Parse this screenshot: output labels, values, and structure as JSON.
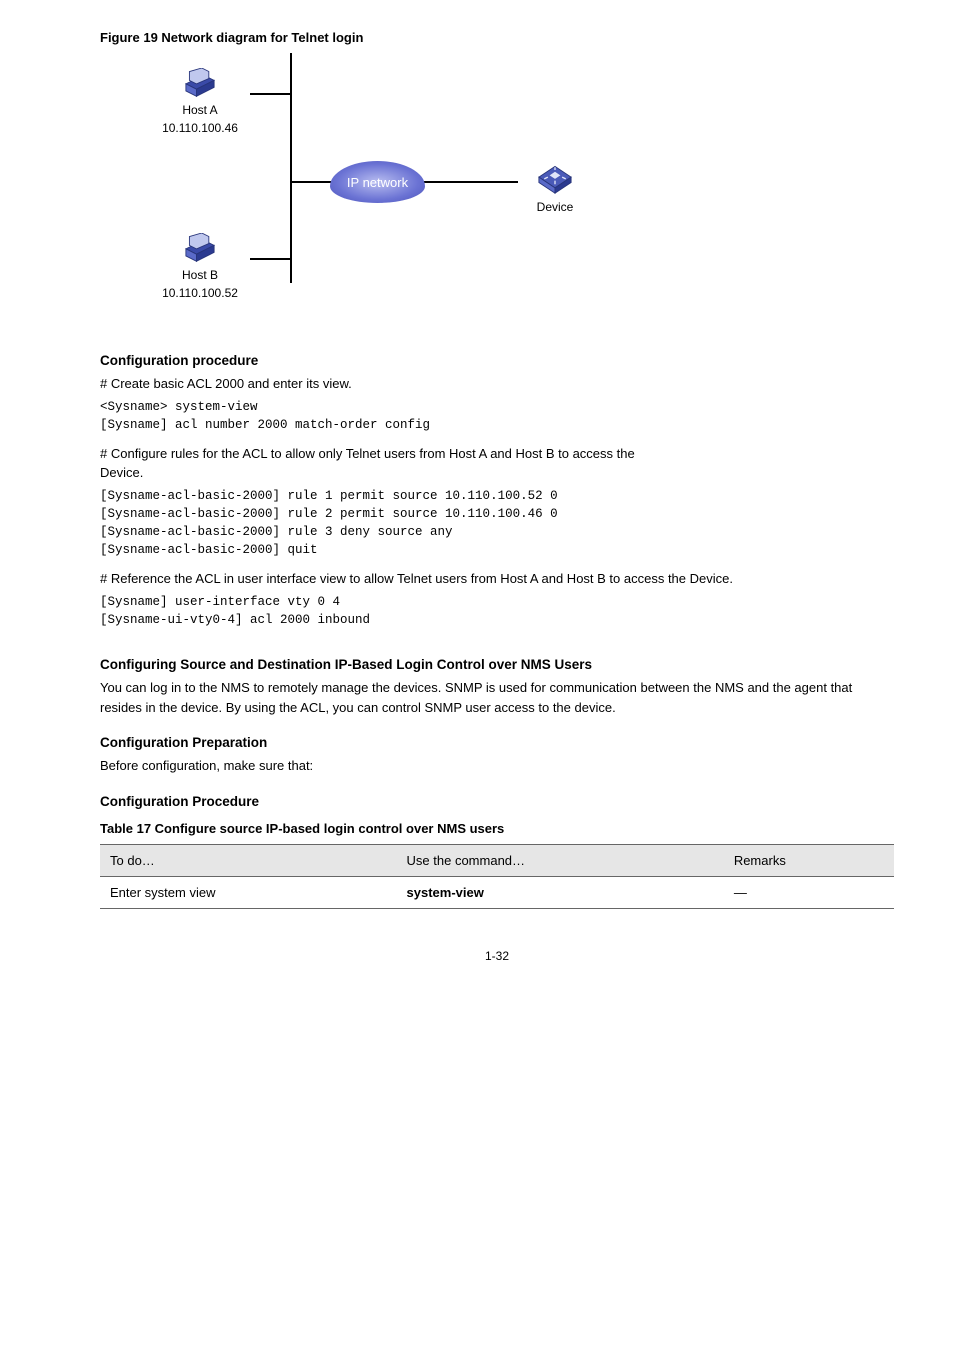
{
  "figure": {
    "caption": "Figure 19 Network diagram for Telnet login",
    "host_a": "Host A",
    "host_a_ip": "10.110.100.46",
    "host_b": "Host B",
    "host_b_ip": "10.110.100.52",
    "cloud": "IP network",
    "device": "Device"
  },
  "sec1": "Configuration procedure",
  "intro": "# Create basic ACL 2000 and enter its view.",
  "cmd1": "<Sysname> system-view",
  "cmd2": "[Sysname] acl number 2000 match-order config",
  "intro2a": "# Configure rules for the ACL to allow only Telnet users from Host A and Host B to access the",
  "intro2b": "Device.",
  "cmd3": "[Sysname-acl-basic-2000] rule 1 permit source 10.110.100.52 0",
  "cmd4": "[Sysname-acl-basic-2000] rule 2 permit source 10.110.100.46 0",
  "cmd5": "[Sysname-acl-basic-2000] rule 3 deny source any",
  "cmd6": "[Sysname-acl-basic-2000] quit",
  "intro3": "# Reference the ACL in user interface view to allow Telnet users from Host A and Host B to access the Device.",
  "cmd7": "[Sysname] user-interface vty 0 4",
  "cmd8": "[Sysname-ui-vty0-4] acl 2000 inbound",
  "sec2": "Configuring Source and Destination IP-Based Login Control over NMS Users",
  "para2": "You can log in to the NMS to remotely manage the devices. SNMP is used for communication between the NMS and the agent that resides in the device. By using the ACL, you can control SNMP user access to the device.",
  "sec3": "Configuration Preparation",
  "para3": "Before configuration, make sure that:",
  "sec4": "Configuration Procedure",
  "table": {
    "caption": "Table 17 Configure source IP-based login control over NMS users",
    "h1": "To do…",
    "h2": "Use the command…",
    "h3": "Remarks",
    "r1c1": "Enter system view",
    "r1c2": "system-view",
    "r1c3": "—"
  },
  "pagenum": "1-32"
}
